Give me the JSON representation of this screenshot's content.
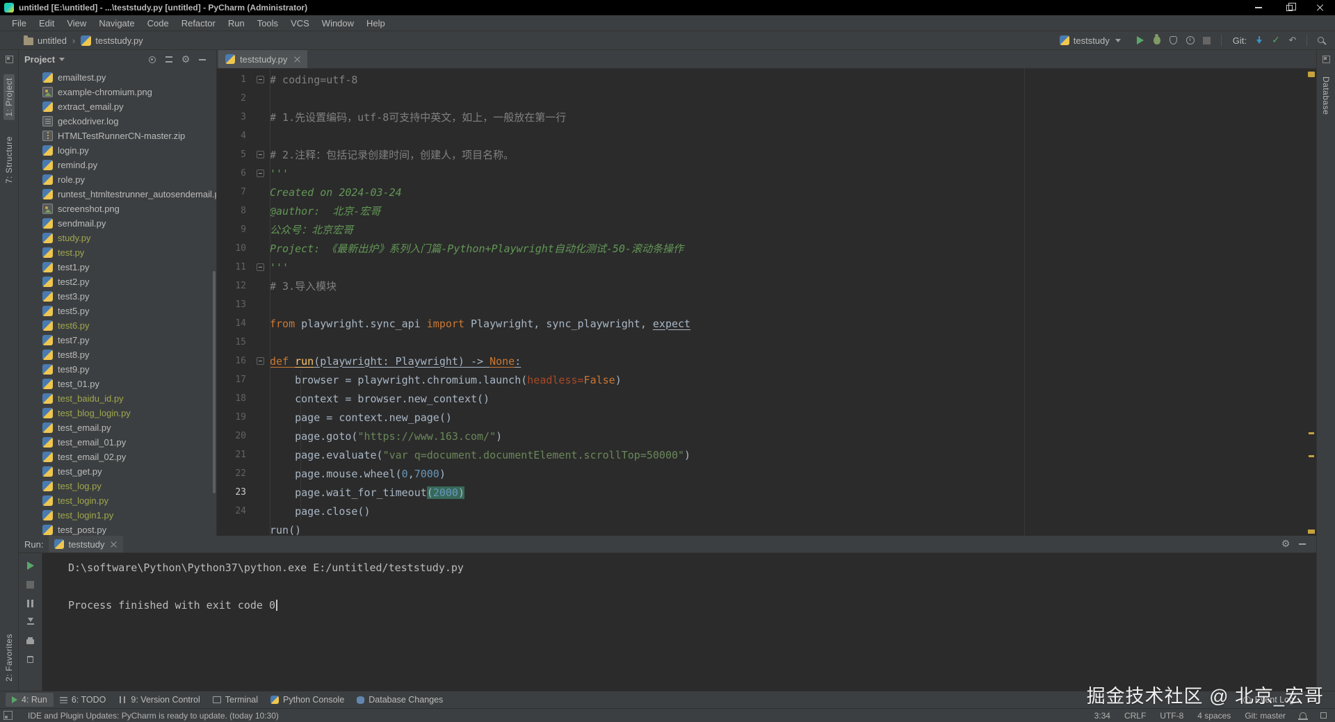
{
  "window": {
    "title": "untitled [E:\\untitled] - ...\\teststudy.py [untitled] - PyCharm (Administrator)"
  },
  "menu": [
    "File",
    "Edit",
    "View",
    "Navigate",
    "Code",
    "Refactor",
    "Run",
    "Tools",
    "VCS",
    "Window",
    "Help"
  ],
  "navbar": {
    "breadcrumb": [
      "untitled",
      "teststudy.py"
    ],
    "run_config": "teststudy",
    "git_label": "Git:",
    "tools": [
      "run",
      "debug",
      "coverage",
      "profiler",
      "stop"
    ],
    "git_tools": [
      "update",
      "commit",
      "revert"
    ]
  },
  "left_stripe": {
    "top": [
      "1: Project",
      "7: Structure"
    ],
    "bottom": [
      "2: Favorites"
    ]
  },
  "right_stripe": {
    "labels": [
      "Database"
    ]
  },
  "project": {
    "title": "Project",
    "tools": [
      "locate",
      "collapse",
      "settings",
      "hide"
    ],
    "files": [
      {
        "name": "emailtest.py",
        "icon": "py"
      },
      {
        "name": "example-chromium.png",
        "icon": "image"
      },
      {
        "name": "extract_email.py",
        "icon": "py"
      },
      {
        "name": "geckodriver.log",
        "icon": "log"
      },
      {
        "name": "HTMLTestRunnerCN-master.zip",
        "icon": "zip"
      },
      {
        "name": "login.py",
        "icon": "py"
      },
      {
        "name": "remind.py",
        "icon": "py"
      },
      {
        "name": "role.py",
        "icon": "py"
      },
      {
        "name": "runtest_htmltestrunner_autosendemail.p",
        "icon": "py"
      },
      {
        "name": "screenshot.png",
        "icon": "image"
      },
      {
        "name": "sendmail.py",
        "icon": "py"
      },
      {
        "name": "study.py",
        "icon": "py",
        "status": "olive"
      },
      {
        "name": "test.py",
        "icon": "py",
        "status": "olive"
      },
      {
        "name": "test1.py",
        "icon": "py"
      },
      {
        "name": "test2.py",
        "icon": "py"
      },
      {
        "name": "test3.py",
        "icon": "py"
      },
      {
        "name": "test5.py",
        "icon": "py"
      },
      {
        "name": "test6.py",
        "icon": "py",
        "status": "olive"
      },
      {
        "name": "test7.py",
        "icon": "py"
      },
      {
        "name": "test8.py",
        "icon": "py"
      },
      {
        "name": "test9.py",
        "icon": "py"
      },
      {
        "name": "test_01.py",
        "icon": "py"
      },
      {
        "name": "test_baidu_id.py",
        "icon": "py",
        "status": "olive"
      },
      {
        "name": "test_blog_login.py",
        "icon": "py",
        "status": "olive"
      },
      {
        "name": "test_email.py",
        "icon": "py"
      },
      {
        "name": "test_email_01.py",
        "icon": "py"
      },
      {
        "name": "test_email_02.py",
        "icon": "py"
      },
      {
        "name": "test_get.py",
        "icon": "py"
      },
      {
        "name": "test_log.py",
        "icon": "py",
        "status": "olive"
      },
      {
        "name": "test_login.py",
        "icon": "py",
        "status": "olive"
      },
      {
        "name": "test_login1.py",
        "icon": "py",
        "status": "olive"
      },
      {
        "name": "test_post.py",
        "icon": "py"
      }
    ]
  },
  "editor": {
    "tab": "teststudy.py",
    "lines": [
      {
        "n": "1",
        "fold": true,
        "tokens": [
          {
            "t": "# coding=utf-8",
            "c": "com"
          }
        ]
      },
      {
        "n": "2",
        "tokens": []
      },
      {
        "n": "3",
        "tokens": [
          {
            "t": "# 1.先设置编码，utf-8可支持中英文，如上，一般放在第一行",
            "c": "com"
          }
        ]
      },
      {
        "n": "4",
        "tokens": []
      },
      {
        "n": "5",
        "fold": true,
        "tokens": [
          {
            "t": "# 2.注释：包括记录创建时间，创建人，项目名称。",
            "c": "com"
          }
        ]
      },
      {
        "n": "6",
        "fold": true,
        "tokens": [
          {
            "t": "'''",
            "c": "doc"
          }
        ]
      },
      {
        "n": "7",
        "tokens": [
          {
            "t": "Created on 2024-03-24",
            "c": "doc"
          }
        ]
      },
      {
        "n": "8",
        "tokens": [
          {
            "t": "@author:  北京-宏哥",
            "c": "doc"
          }
        ]
      },
      {
        "n": "9",
        "tokens": [
          {
            "t": "公众号：北京宏哥",
            "c": "doc"
          }
        ]
      },
      {
        "n": "10",
        "tokens": [
          {
            "t": "Project: 《最新出炉》系列入门篇-Python+Playwright自动化测试-50-滚动条操作",
            "c": "doc"
          }
        ]
      },
      {
        "n": "11",
        "fold": true,
        "tokens": [
          {
            "t": "'''",
            "c": "doc"
          }
        ]
      },
      {
        "n": "12",
        "tokens": [
          {
            "t": "# 3.导入模块",
            "c": "com"
          }
        ]
      },
      {
        "n": "13",
        "tokens": []
      },
      {
        "n": "14",
        "tokens": [
          {
            "t": "from",
            "c": "kw"
          },
          {
            "t": " playwright.sync_api ",
            "c": "def"
          },
          {
            "t": "import",
            "c": "kw"
          },
          {
            "t": " Playwright, sync_playwright, ",
            "c": "def"
          },
          {
            "t": "expect",
            "c": "def",
            "u": true
          }
        ]
      },
      {
        "n": "15",
        "tokens": []
      },
      {
        "n": "16",
        "fold": true,
        "tokens": [
          {
            "t": "def ",
            "c": "kw",
            "u": true
          },
          {
            "t": "run",
            "c": "fn",
            "u": true
          },
          {
            "t": "(playwright: Playwright) -> ",
            "c": "def",
            "u": true
          },
          {
            "t": "None",
            "c": "kw",
            "u": true
          },
          {
            "t": ":",
            "c": "def",
            "u": true
          }
        ]
      },
      {
        "n": "17",
        "tokens": [
          {
            "t": "    browser = playwright.chromium.launch(",
            "c": "def"
          },
          {
            "t": "headless",
            "c": "kwarg"
          },
          {
            "t": "=",
            "c": "kwarg"
          },
          {
            "t": "False",
            "c": "kw"
          },
          {
            "t": ")",
            "c": "def"
          }
        ]
      },
      {
        "n": "18",
        "tokens": [
          {
            "t": "    context = browser.new_context()",
            "c": "def"
          }
        ]
      },
      {
        "n": "19",
        "tokens": [
          {
            "t": "    page = context.new_page()",
            "c": "def"
          }
        ]
      },
      {
        "n": "20",
        "tokens": [
          {
            "t": "    page.goto(",
            "c": "def"
          },
          {
            "t": "\"https://www.163.com/\"",
            "c": "str"
          },
          {
            "t": ")",
            "c": "def"
          }
        ]
      },
      {
        "n": "21",
        "tokens": [
          {
            "t": "    page.evaluate(",
            "c": "def"
          },
          {
            "t": "\"var q=document.documentElement.scrollTop=50000\"",
            "c": "str"
          },
          {
            "t": ")",
            "c": "def"
          }
        ]
      },
      {
        "n": "22",
        "tokens": [
          {
            "t": "    page.mouse.wheel(",
            "c": "def"
          },
          {
            "t": "0",
            "c": "num"
          },
          {
            "t": ",",
            "c": "def"
          },
          {
            "t": "7000",
            "c": "num"
          },
          {
            "t": ")",
            "c": "def"
          }
        ]
      },
      {
        "n": "23",
        "current": true,
        "tokens": [
          {
            "t": "    page.wait_for_timeout",
            "c": "def"
          },
          {
            "t": "(",
            "c": "def",
            "hl": true
          },
          {
            "t": "2000",
            "c": "num",
            "hl": true
          },
          {
            "t": ")",
            "c": "def",
            "hl": true
          }
        ]
      },
      {
        "n": "24",
        "tokens": [
          {
            "t": "    page.close()",
            "c": "def"
          }
        ]
      },
      {
        "n": "",
        "tokens": [
          {
            "t": "run()",
            "c": "def"
          }
        ]
      }
    ]
  },
  "run_panel": {
    "label": "Run:",
    "tab": "teststudy",
    "tools": [
      "settings",
      "hide"
    ],
    "side_toolbar": [
      "rerun",
      "stop",
      "pause",
      "scroll-end",
      "print",
      "clear"
    ],
    "console": [
      {
        "text": "D:\\software\\Python\\Python37\\python.exe E:/untitled/teststudy.py"
      },
      {
        "text": ""
      },
      {
        "text": "Process finished with exit code 0",
        "caret": true
      }
    ]
  },
  "bottom_bar": {
    "left": [
      {
        "label": "4: Run",
        "icon": "run",
        "active": true
      },
      {
        "label": "6: TODO",
        "icon": "todo"
      },
      {
        "label": "9: Version Control",
        "icon": "vcs"
      },
      {
        "label": "Terminal",
        "icon": "terminal"
      },
      {
        "label": "Python Console",
        "icon": "python"
      },
      {
        "label": "Database Changes",
        "icon": "db"
      }
    ],
    "right": [
      {
        "label": "Event Log",
        "icon": "event"
      }
    ]
  },
  "status_bar": {
    "message": "IDE and Plugin Updates: PyCharm is ready to update. (today 10:30)",
    "items": [
      "3:34",
      "CRLF",
      "UTF-8",
      "4 spaces",
      "Git: master"
    ]
  },
  "watermark": "掘金技术社区 @ 北京_宏哥"
}
